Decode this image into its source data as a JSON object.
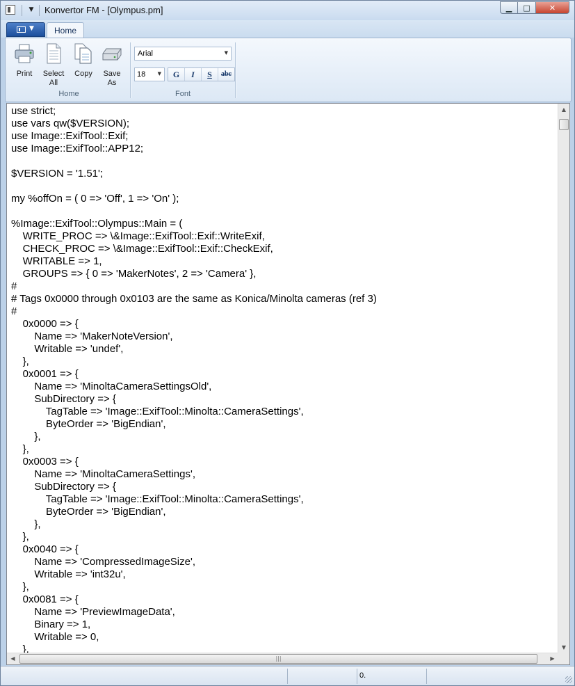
{
  "window": {
    "title": "Konvertor FM - [Olympus.pm]",
    "controls": {
      "minimize": "▁",
      "maximize": "□",
      "close": "✕"
    }
  },
  "ribbon": {
    "tabs": [
      {
        "label": "Home",
        "active": true
      }
    ],
    "groups": {
      "home": {
        "label": "Home",
        "buttons": {
          "print": "Print",
          "select_all_1": "Select",
          "select_all_2": "All",
          "copy": "Copy",
          "save_as_1": "Save",
          "save_as_2": "As"
        }
      },
      "font": {
        "label": "Font",
        "font_name": "Arial",
        "font_size": "18",
        "bold": "G",
        "italic": "I",
        "underline": "S",
        "strikethrough": "abc"
      }
    }
  },
  "editor": {
    "lines": [
      "use strict;",
      "use vars qw($VERSION);",
      "use Image::ExifTool::Exif;",
      "use Image::ExifTool::APP12;",
      "",
      "$VERSION = '1.51';",
      "",
      "my %offOn = ( 0 => 'Off', 1 => 'On' );",
      "",
      "%Image::ExifTool::Olympus::Main = (",
      "    WRITE_PROC => \\&Image::ExifTool::Exif::WriteExif,",
      "    CHECK_PROC => \\&Image::ExifTool::Exif::CheckExif,",
      "    WRITABLE => 1,",
      "    GROUPS => { 0 => 'MakerNotes', 2 => 'Camera' },",
      "#",
      "# Tags 0x0000 through 0x0103 are the same as Konica/Minolta cameras (ref 3)",
      "#",
      "    0x0000 => {",
      "        Name => 'MakerNoteVersion',",
      "        Writable => 'undef',",
      "    },",
      "    0x0001 => {",
      "        Name => 'MinoltaCameraSettingsOld',",
      "        SubDirectory => {",
      "            TagTable => 'Image::ExifTool::Minolta::CameraSettings',",
      "            ByteOrder => 'BigEndian',",
      "        },",
      "    },",
      "    0x0003 => {",
      "        Name => 'MinoltaCameraSettings',",
      "        SubDirectory => {",
      "            TagTable => 'Image::ExifTool::Minolta::CameraSettings',",
      "            ByteOrder => 'BigEndian',",
      "        },",
      "    },",
      "    0x0040 => {",
      "        Name => 'CompressedImageSize',",
      "        Writable => 'int32u',",
      "    },",
      "    0x0081 => {",
      "        Name => 'PreviewImageData',",
      "        Binary => 1,",
      "        Writable => 0,",
      "    },"
    ]
  },
  "statusbar": {
    "position": "0."
  }
}
